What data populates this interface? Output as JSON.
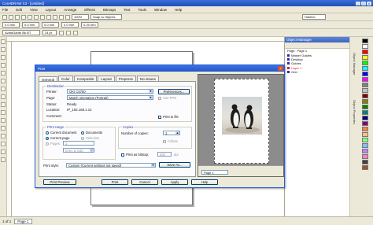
{
  "window": {
    "title": "CorelDRAW X3 - [Untitled]",
    "min": "_",
    "max": "□",
    "close": "x"
  },
  "menu": [
    "File",
    "Edit",
    "View",
    "Layout",
    "Arrange",
    "Effects",
    "Bitmaps",
    "Text",
    "Tools",
    "Window",
    "Help"
  ],
  "toolbar": {
    "snap": "Snap to Objects",
    "zoom": "100%",
    "hairline": "Hairline"
  },
  "propbar": {
    "x": "0.0 mm",
    "y": "0.0 mm",
    "w": "0.0 mm",
    "h": "0.0 mm",
    "font": "AvantGarde Bk BT",
    "size": "24 pt",
    "nudge": "0.25 mm"
  },
  "object_manager": {
    "title": "Object Manager",
    "page_label": "Page:",
    "page_value": "Page 1",
    "items": [
      "Master Guides",
      "Desktop",
      "Guides",
      "Layer 1",
      "Grid"
    ]
  },
  "docker_tabs": [
    "Object Manager",
    "Object Properties"
  ],
  "palette": [
    "#000000",
    "#ffffff",
    "#ff0000",
    "#ffff00",
    "#00ff00",
    "#00ffff",
    "#0000ff",
    "#ff00ff",
    "#808080",
    "#c0c0c0",
    "#800000",
    "#808000",
    "#008000",
    "#008080",
    "#000080",
    "#800080",
    "#ff8040",
    "#ffc080",
    "#80ff80",
    "#80c0ff",
    "#c080ff",
    "#ff80c0",
    "#404040",
    "#a0522d"
  ],
  "status": {
    "page_of": "1 of 1",
    "page": "Page 1"
  },
  "dialog": {
    "title": "Print",
    "close": "x",
    "tabs": [
      "General",
      "Color",
      "Composite",
      "Layout",
      "Prepress",
      "No Issues"
    ],
    "destination": {
      "label": "Destination",
      "printer_label": "Printer:",
      "printer_value": "OKI C5750",
      "preferences": "Preferences...",
      "page_label": "Page:",
      "page_value": "Match orientation (Portrait)",
      "use_ppd": "Use PPD",
      "status_label": "Status:",
      "status_value": "Ready",
      "location_label": "Location:",
      "location_value": "IP_192.168.1.14",
      "comment_label": "Comment:",
      "print_to_file": "Print to file"
    },
    "print_range": {
      "label": "Print range",
      "current_document": "Current document",
      "documents": "Documents",
      "current_page": "Current page",
      "selection": "Selection",
      "pages": "Pages:",
      "pages_value": "1",
      "even_odd": "Even & Odd"
    },
    "copies": {
      "label": "Copies",
      "number_label": "Number of copies:",
      "number_value": "1",
      "collate": "Collate"
    },
    "print_as_bitmap": "Print as bitmap:",
    "bitmap_dpi": "300",
    "dpi_label": "dpi",
    "print_style_label": "Print style:",
    "print_style_value": "Custom (Current settings not saved)",
    "save_as": "Save As...",
    "buttons": [
      "Print Preview",
      "Print",
      "Cancel",
      "Apply",
      "Help"
    ],
    "preview_page": "Page 1"
  }
}
